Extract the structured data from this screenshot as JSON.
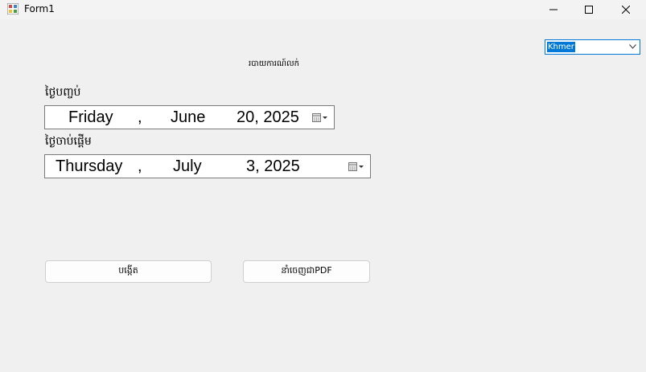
{
  "window": {
    "title": "Form1"
  },
  "language_select": {
    "value": "Khmer"
  },
  "report": {
    "heading": "របាយការណ៍លក់"
  },
  "start_date": {
    "label": "ថ្ងៃបញ្ចប់",
    "weekday": "Friday",
    "comma": ",",
    "month": "June",
    "day_year": "20, 2025"
  },
  "end_date": {
    "label": "ថ្ងៃចាប់ផ្តើម",
    "weekday": "Thursday",
    "comma": ",",
    "month": "July",
    "day_year": "3, 2025"
  },
  "buttons": {
    "generate": "បង្កើត",
    "export_pdf": "នាំចេញជាPDF"
  }
}
